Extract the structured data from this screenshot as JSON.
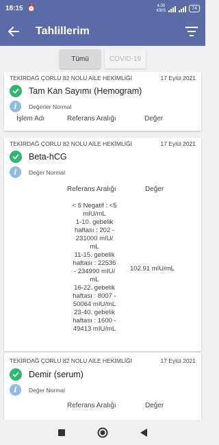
{
  "status_bar": {
    "time": "18:15",
    "network_speed": "4.00",
    "network_unit": "KB/S",
    "battery": "74"
  },
  "app_bar": {
    "title": "Tahlillerim"
  },
  "tabs": [
    {
      "label": "Tümü",
      "active": true
    },
    {
      "label": "COVID-19",
      "active": false
    }
  ],
  "cards": [
    {
      "clinic": "TEKİRDAĞ ÇORLU 82 NOLU  AİLE HEKİMLİĞİ",
      "date": "17 Eylül 2021",
      "test_name": "Tam Kan Sayımı (Hemogram)",
      "status": "Değerler Normal",
      "columns": {
        "procedure": "İşlem Adı",
        "reference": "Referans Aralığı",
        "value": "Değer"
      }
    },
    {
      "clinic": "TEKİRDAĞ ÇORLU 82 NOLU  AİLE HEKİMLİĞİ",
      "date": "17 Eylül 2021",
      "test_name": "Beta-hCG",
      "status": "Değer Normal",
      "columns": {
        "reference": "Referans Aralığı",
        "value": "Değer"
      },
      "reference_lines": [
        "< 5 Negatif : <5",
        "mIU/mL",
        "1-10.  gebelik",
        "haftası : 202 -",
        "231000  mIU/",
        "mL",
        "11-15. gebelik",
        "haftası : 22536",
        "- 234990  mIU/",
        "mL",
        "16-22. gebelik",
        "haftası : 8007 -",
        "50064  mIU/mL",
        "23-40. gebelik",
        "haftası : 1600 -",
        "49413  mIU/mL"
      ],
      "result": "102.91 mIU/mL"
    },
    {
      "clinic": "TEKİRDAĞ ÇORLU 82 NOLU  AİLE HEKİMLİĞİ",
      "date": "17 Eylül 2021",
      "test_name": "Demir (serum)",
      "status": "Değer Normal",
      "columns": {
        "reference": "Referans Aralığı",
        "value": "Değer"
      }
    }
  ]
}
